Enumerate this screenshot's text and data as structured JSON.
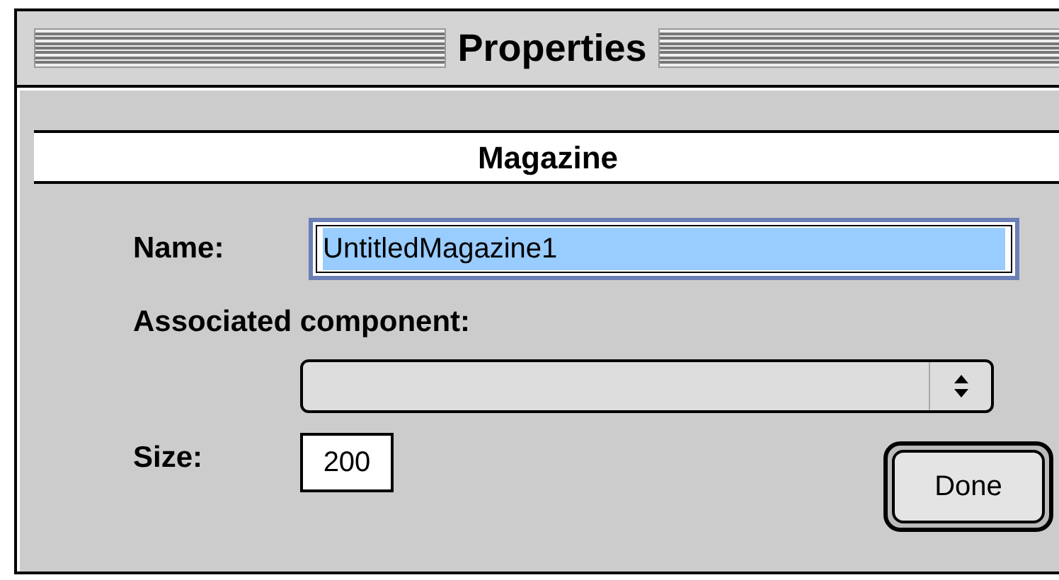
{
  "window": {
    "title": "Properties"
  },
  "section": {
    "title": "Magazine"
  },
  "name_field": {
    "label": "Name:",
    "value": "UntitledMagazine1",
    "text_selected": true
  },
  "component": {
    "label": "Associated component:"
  },
  "size_field": {
    "label": "Size:",
    "value": "200"
  },
  "buttons": [
    {
      "label": "Done",
      "default": true
    }
  ]
}
